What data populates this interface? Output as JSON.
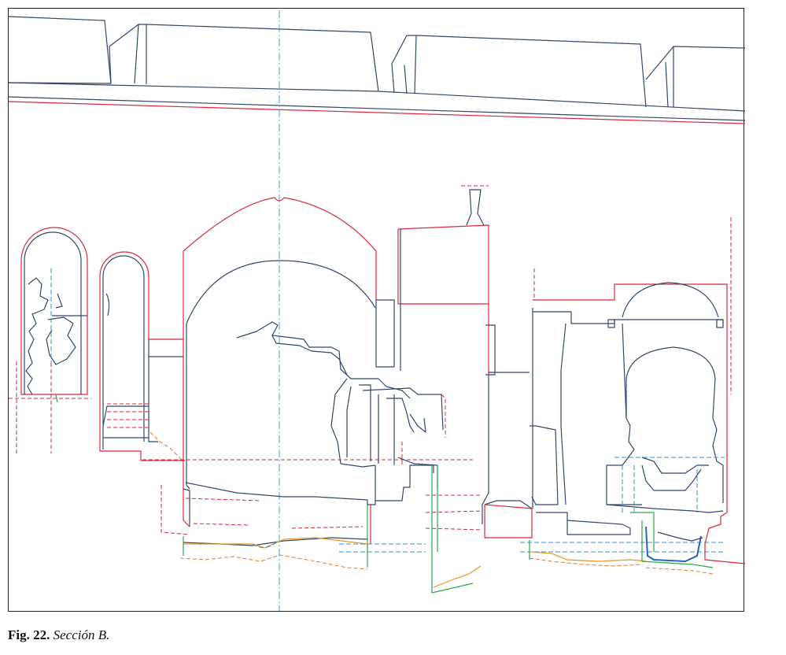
{
  "caption": {
    "figure_label": "Fig. 22.",
    "title": "Sección B."
  },
  "line_colors": {
    "structure": "#33486b",
    "section_red": "#d8283c",
    "orange": "#e8961f",
    "green": "#2fa84a",
    "axis_blue": "#4aa0d8",
    "water_blue": "#2466b8"
  }
}
